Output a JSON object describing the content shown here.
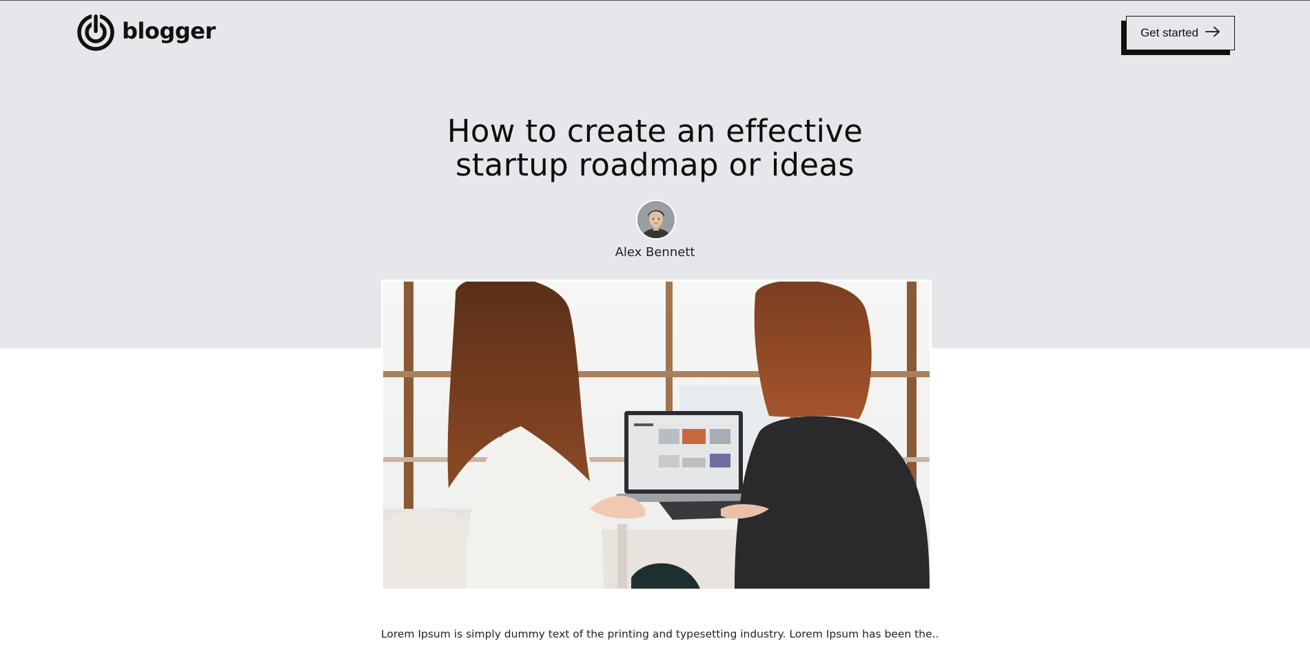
{
  "brand": {
    "name": "blogger",
    "logo_icon": "power-ring-icon"
  },
  "header": {
    "cta_label": "Get started",
    "cta_icon": "arrow-right-icon"
  },
  "article": {
    "title_line1": "How to create an effective",
    "title_line2": "startup roadmap or ideas",
    "author": "Alex Bennett",
    "excerpt": "Lorem Ipsum is simply dummy text of the printing and typesetting industry. Lorem Ipsum has been the.."
  },
  "colors": {
    "hero_background": "#e6e7eb",
    "text": "#111111",
    "page_background": "#ffffff"
  }
}
